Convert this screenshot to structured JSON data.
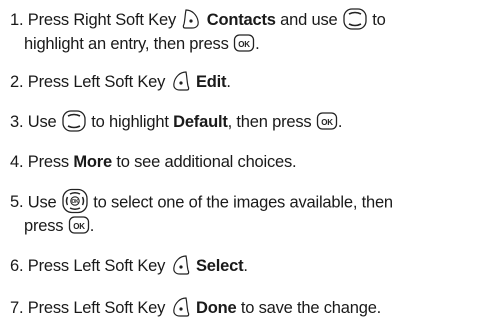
{
  "steps": [
    {
      "num": "1.",
      "a": "Press Right Soft Key",
      "icon1": "right-soft-key-icon",
      "bold1": "Contacts",
      "b": "and use",
      "icon2": "nav-key-up-down-icon",
      "c": "to",
      "line2a": "highlight an entry, then press",
      "icon3": "ok-key-icon",
      "line2b": "."
    },
    {
      "num": "2.",
      "a": "Press Left Soft Key",
      "icon1": "left-soft-key-icon",
      "bold1": "Edit",
      "end": "."
    },
    {
      "num": "3.",
      "a": "Use",
      "icon1": "nav-key-up-down-icon",
      "b": "to highlight",
      "bold1": "Default",
      "c": ", then press",
      "icon2": "ok-key-icon",
      "end": "."
    },
    {
      "num": "4.",
      "a": "Press",
      "bold1": "More",
      "b": "to see additional choices."
    },
    {
      "num": "5.",
      "a": "Use",
      "icon1": "nav-key-all-directions-icon",
      "b": "to select one of the images available, then",
      "line2a": "press",
      "icon2": "ok-key-icon",
      "line2b": "."
    },
    {
      "num": "6.",
      "a": "Press Left Soft Key",
      "icon1": "left-soft-key-icon",
      "bold1": "Select",
      "end": "."
    },
    {
      "num": "7.",
      "a": "Press Left Soft Key",
      "icon1": "left-soft-key-icon",
      "bold1": "Done",
      "b": "to save the change."
    }
  ]
}
